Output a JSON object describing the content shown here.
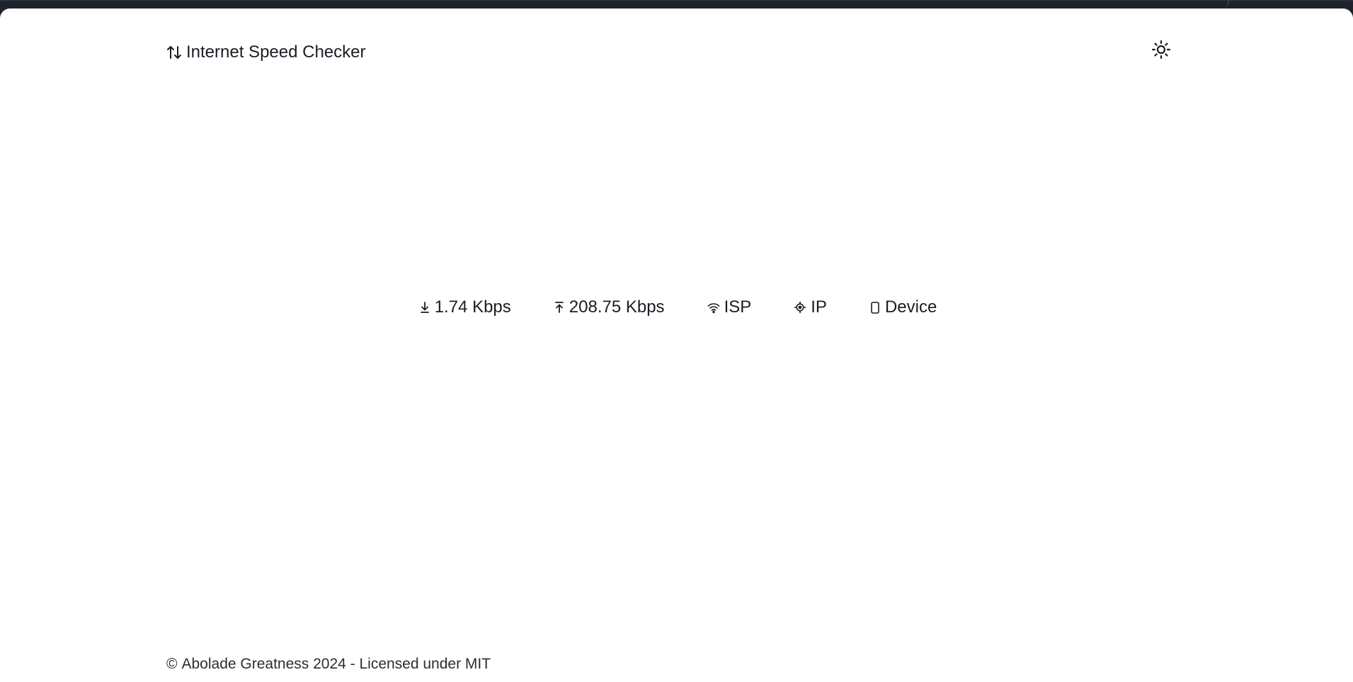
{
  "app": {
    "title": "Internet Speed Checker",
    "logo_icon": "arrows-up-down-icon"
  },
  "header": {
    "theme_toggle_icon": "sun-icon"
  },
  "stats": {
    "download": {
      "icon": "download-icon",
      "value": "1.74 Kbps"
    },
    "upload": {
      "icon": "upload-icon",
      "value": "208.75 Kbps"
    },
    "isp": {
      "icon": "wifi-icon",
      "label": "ISP"
    },
    "ip": {
      "icon": "location-target-icon",
      "label": "IP"
    },
    "device": {
      "icon": "device-icon",
      "label": "Device"
    }
  },
  "footer": {
    "copyright_symbol": "©",
    "text": "Abolade Greatness 2024 - Licensed under MIT"
  },
  "colors": {
    "background": "#ffffff",
    "text": "#1a1d24",
    "window_chrome": "#1c2029"
  }
}
